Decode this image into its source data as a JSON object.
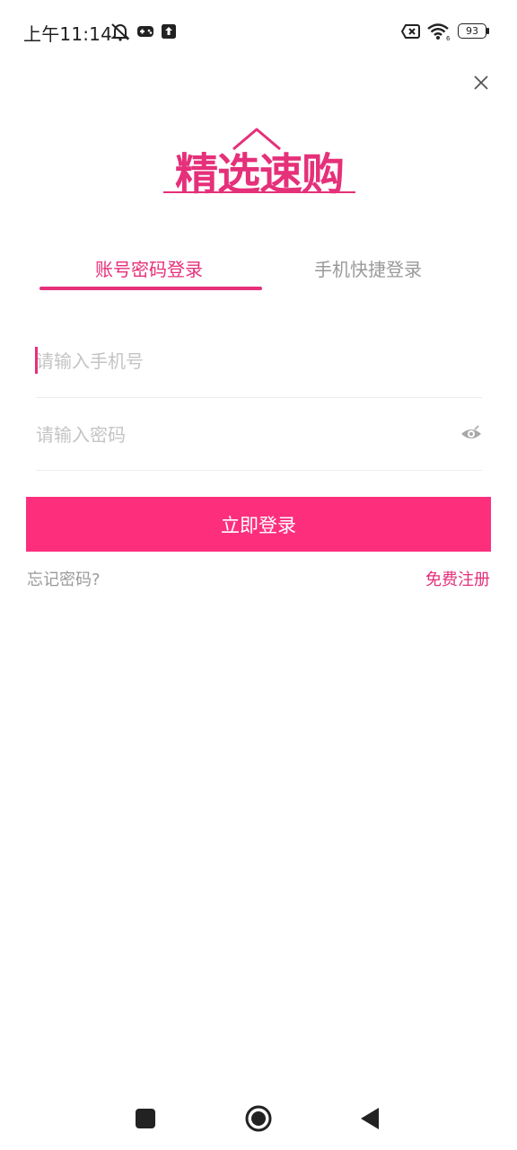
{
  "status_bar": {
    "time": "上午11:14",
    "battery": "93",
    "icons": [
      "mute-bell-icon",
      "game-icon",
      "upload-icon",
      "sim-off-icon",
      "wifi-icon",
      "battery-icon"
    ]
  },
  "logo": {
    "text": "精选速购",
    "color": "#e5307a"
  },
  "tabs": [
    {
      "label": "账号密码登录",
      "active": true
    },
    {
      "label": "手机快捷登录",
      "active": false
    }
  ],
  "form": {
    "phone_placeholder": "请输入手机号",
    "password_placeholder": "请输入密码",
    "login_label": "立即登录",
    "forgot_label": "忘记密码?",
    "register_label": "免费注册"
  },
  "colors": {
    "accent": "#e5307a",
    "button": "#fd2f7d",
    "muted": "#9a9a9a"
  }
}
